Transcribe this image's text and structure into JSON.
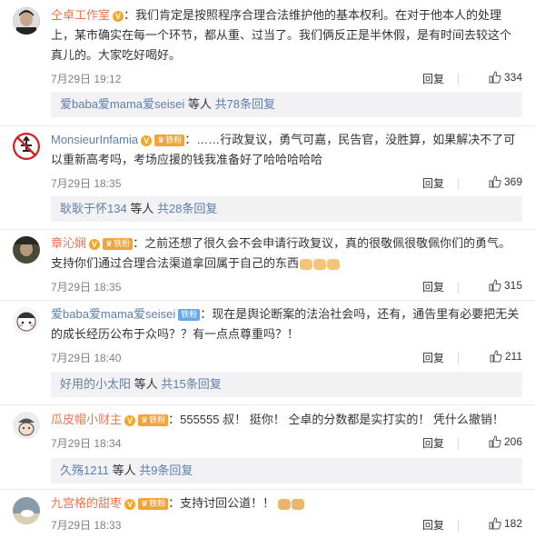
{
  "comments": [
    {
      "username": "仝卓工作室",
      "text": "：我们肯定是按照程序合理合法维护他的基本权利。在对于他本人的处理上，某市确实在每一个环节，都从重、过当了。我们俩反正是半休假，是有时间去较这个真儿的。大家吃好喝好。",
      "time": "7月29日 19:12",
      "reply": "回复",
      "likes": "334",
      "sub": {
        "user": "爱baba爱mama爱seisei",
        "mid": " 等人 ",
        "count": "共78条回复"
      }
    },
    {
      "username": "MonsieurInfamia",
      "fan_badge": "铁粉",
      "text": "：……行政复议，勇气可嘉，民告官，没胜算，如果解决不了可以重新高考吗，考场应援的钱我准备好了哈哈哈哈哈",
      "time": "7月29日 18:35",
      "reply": "回复",
      "likes": "369",
      "sub": {
        "user": "耿耿于怀134",
        "mid": " 等人 ",
        "count": "共28条回复"
      }
    },
    {
      "username": "章沁娴",
      "fan_badge": "铁粉",
      "text": "：之前还想了很久会不会申请行政复议，真的很敬佩很敬佩你们的勇气。支持你们通过合理合法渠道拿回属于自己的东西",
      "time": "7月29日 18:35",
      "reply": "回复",
      "likes": "315"
    },
    {
      "username": "爱baba爱mama爱seisei",
      "fan_badge": "铁粉",
      "text": "：现在是舆论断案的法治社会吗，还有，通告里有必要把无关的成长经历公布于众吗？？有一点点尊重吗？！",
      "time": "7月29日 18:40",
      "reply": "回复",
      "likes": "211",
      "sub": {
        "user": "好用的小太阳",
        "mid": " 等人 ",
        "count": "共15条回复"
      }
    },
    {
      "username": "瓜皮帽小财主",
      "fan_badge": "铁粉",
      "text": "：555555 叔！ 挺你！ 仝卓的分数都是实打实的！ 凭什么撤销！",
      "time": "7月29日 18:34",
      "reply": "回复",
      "likes": "206",
      "sub": {
        "user": "久殇1211",
        "mid": " 等人 ",
        "count": "共9条回复"
      }
    },
    {
      "username": "九宫格的甜枣",
      "fan_badge": "铁粉",
      "text": "：支持讨回公道！！",
      "time": "7月29日 18:33",
      "reply": "回复",
      "likes": "182"
    }
  ],
  "icons": {
    "like": "thumbs-up-icon",
    "verified": "v-badge-icon"
  },
  "colors": {
    "username": "#eb7350",
    "link": "#5d7fa8",
    "fan_gold": "#f0a43b",
    "fan_blue": "#67a8e6"
  }
}
